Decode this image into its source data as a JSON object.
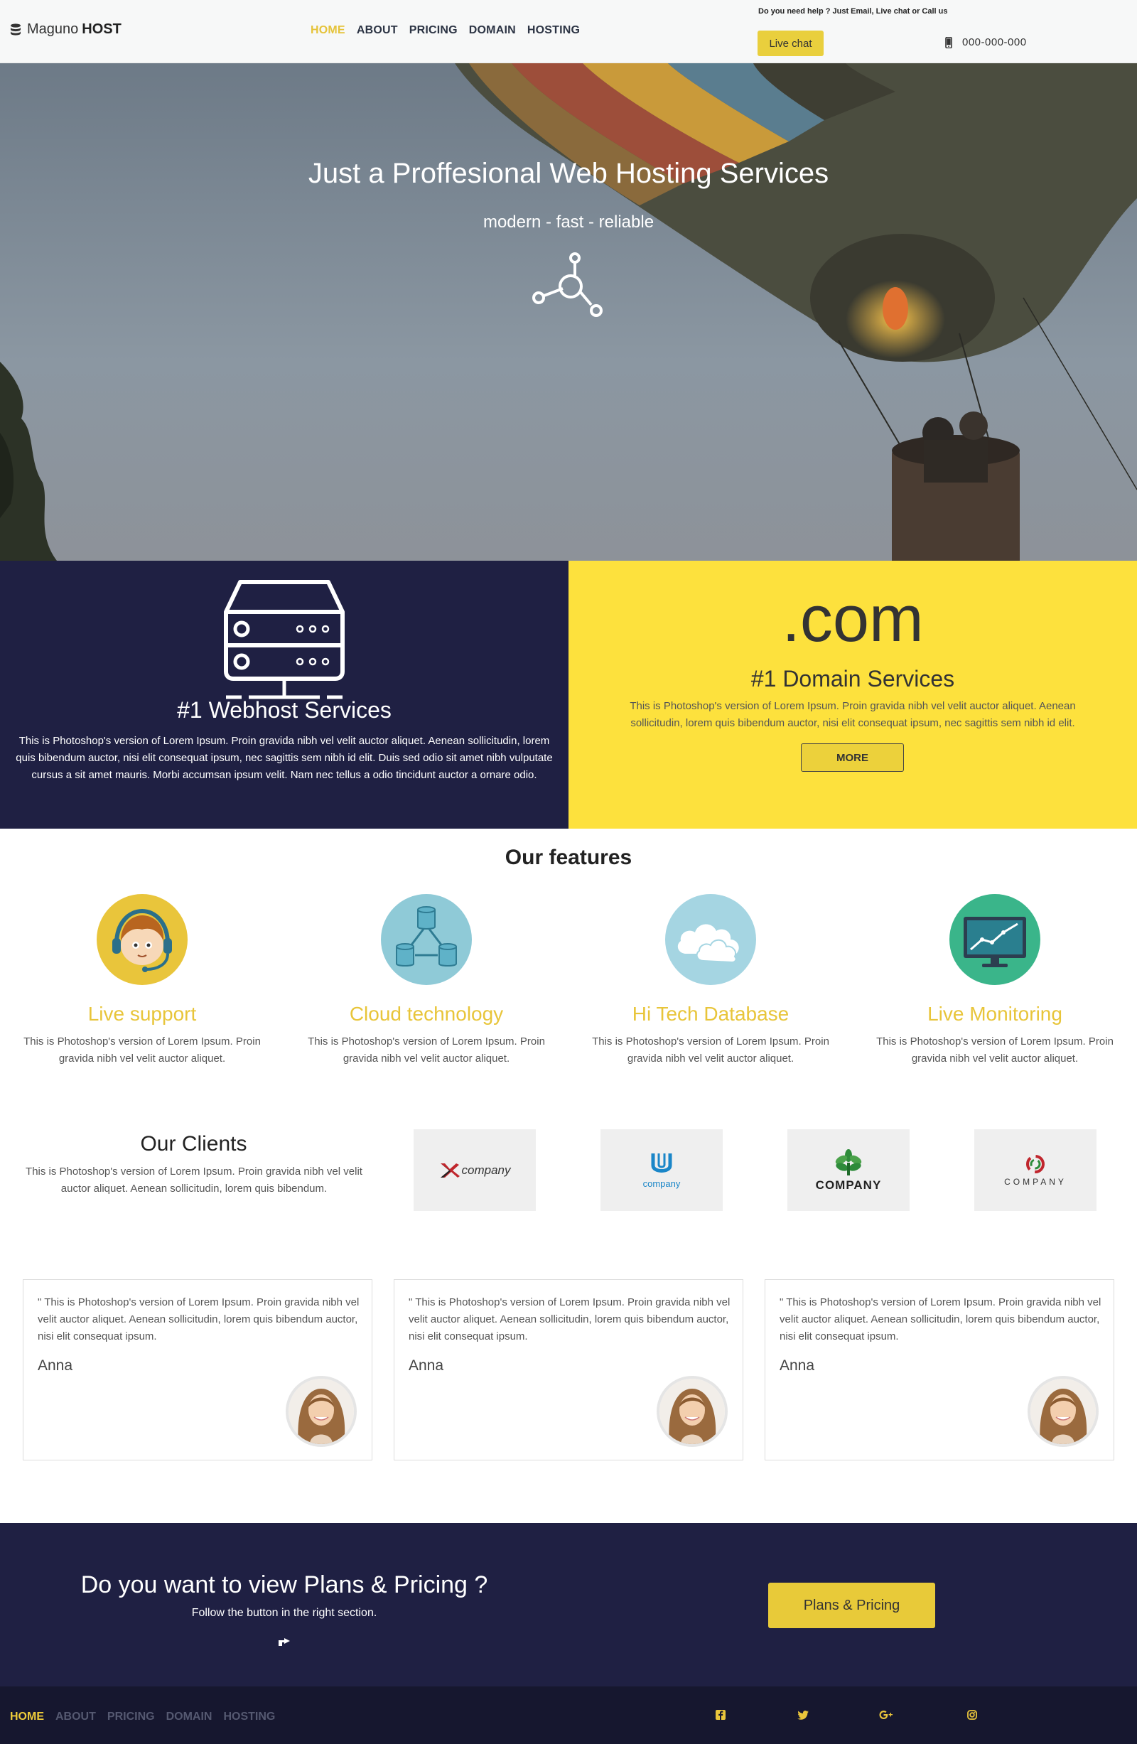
{
  "header": {
    "brand_name": "Maguno",
    "brand_suffix": "HOST",
    "nav": [
      "HOME",
      "ABOUT",
      "PRICING",
      "DOMAIN",
      "HOSTING"
    ],
    "help_text": "Do you need help ? Just Email, Live chat or Call us",
    "live_chat_label": "Live chat",
    "phone": "000-000-000"
  },
  "hero": {
    "title": "Just a Proffesional Web Hosting Services",
    "subtitle": "modern - fast - reliable"
  },
  "services": {
    "webhost": {
      "title": "#1 Webhost Services",
      "text": "This is Photoshop's version of Lorem Ipsum. Proin gravida nibh vel velit auctor aliquet. Aenean sollicitudin, lorem quis bibendum auctor, nisi elit consequat ipsum, nec sagittis sem nibh id elit. Duis sed odio sit amet nibh vulputate cursus a sit amet mauris. Morbi accumsan ipsum velit. Nam nec tellus a odio tincidunt auctor a ornare odio."
    },
    "domain": {
      "tld": ".com",
      "title": "#1 Domain Services",
      "text": "This is Photoshop's version of Lorem Ipsum. Proin gravida nibh vel velit auctor aliquet. Aenean sollicitudin, lorem quis bibendum auctor, nisi elit consequat ipsum, nec sagittis sem nibh id elit.",
      "button_label": "MORE"
    }
  },
  "features": {
    "title": "Our features",
    "items": [
      {
        "title": "Live support",
        "text": "This is Photoshop's version of Lorem Ipsum. Proin gravida nibh vel velit auctor aliquet.",
        "icon": "headset-support-icon",
        "color": "#e9c53b"
      },
      {
        "title": "Cloud technology",
        "text": "This is Photoshop's version of Lorem Ipsum. Proin gravida nibh vel velit auctor aliquet.",
        "icon": "network-database-icon",
        "color": "#8fcad7"
      },
      {
        "title": "Hi Tech Database",
        "text": "This is Photoshop's version of Lorem Ipsum. Proin gravida nibh vel velit auctor aliquet.",
        "icon": "cloud-icon",
        "color": "#a5d5e2"
      },
      {
        "title": "Live Monitoring",
        "text": "This is Photoshop's version of Lorem Ipsum. Proin gravida nibh vel velit auctor aliquet.",
        "icon": "monitor-chart-icon",
        "color": "#3ab58a"
      }
    ]
  },
  "clients": {
    "title": "Our Clients",
    "text": "This is Photoshop's version of Lorem Ipsum. Proin gravida nibh vel velit auctor aliquet. Aenean sollicitudin, lorem quis bibendum.",
    "logos": [
      {
        "label": "company",
        "icon": "x-logo-icon"
      },
      {
        "label": "company",
        "icon": "u-logo-icon"
      },
      {
        "label": "COMPANY",
        "icon": "tree-logo-icon"
      },
      {
        "label": "COMPANY",
        "icon": "swirl-logo-icon"
      }
    ]
  },
  "testimonials": [
    {
      "quote": "\" This is Photoshop's version of Lorem Ipsum. Proin gravida nibh vel velit auctor aliquet. Aenean sollicitudin, lorem quis bibendum auctor, nisi elit consequat ipsum.",
      "name": "Anna"
    },
    {
      "quote": "\" This is Photoshop's version of Lorem Ipsum. Proin gravida nibh vel velit auctor aliquet. Aenean sollicitudin, lorem quis bibendum auctor, nisi elit consequat ipsum.",
      "name": "Anna"
    },
    {
      "quote": "\" This is Photoshop's version of Lorem Ipsum. Proin gravida nibh vel velit auctor aliquet. Aenean sollicitudin, lorem quis bibendum auctor, nisi elit consequat ipsum.",
      "name": "Anna"
    }
  ],
  "cta": {
    "title": "Do you want to view Plans & Pricing ?",
    "subtitle": "Follow the button in the right section.",
    "button_label": "Plans & Pricing"
  },
  "footer": {
    "nav": [
      "HOME",
      "ABOUT",
      "PRICING",
      "DOMAIN",
      "HOSTING"
    ],
    "social": [
      "facebook-icon",
      "twitter-icon",
      "google-plus-icon",
      "instagram-icon"
    ]
  },
  "colors": {
    "accent": "#e9cf3d",
    "navy": "#1f2043",
    "footer": "#16172f",
    "domain_bg": "#fde13d"
  }
}
